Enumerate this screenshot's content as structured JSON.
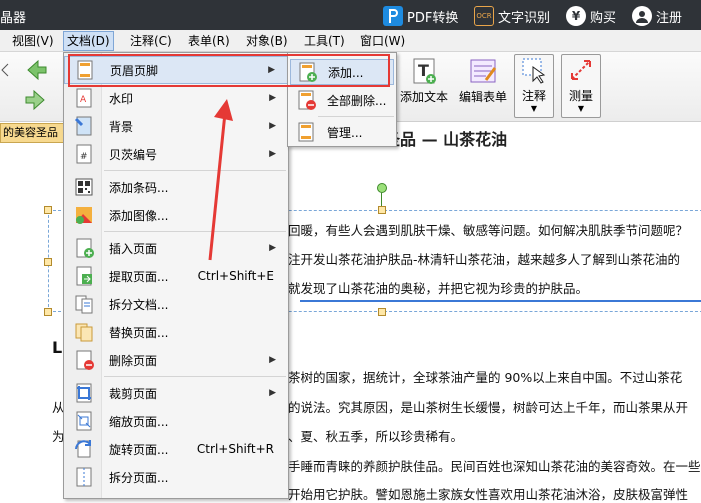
{
  "titlebar": {
    "app_title": "晶器",
    "pdf_convert": "PDF转换",
    "ocr_badge": "OCR",
    "ocr": "文字识别",
    "buy": "购买",
    "register": "注册"
  },
  "menubar": {
    "items": [
      "视图(V)",
      "文档(D)",
      "注释(C)",
      "表单(R)",
      "对象(B)",
      "工具(T)",
      "窗口(W)"
    ]
  },
  "toolbar": {
    "add_text": "添加文本",
    "edit_form": "编辑表单",
    "annotate": "注释",
    "measure": "测量"
  },
  "doc_tab": "的美容圣品",
  "document": {
    "heading": "山茶油的美容圣品  —  山茶花油",
    "lines": [
      "回暖，有些人会遇到肌肤干燥、敏感等问题。如何解决肌肤季节问题呢？",
      "注开发山茶花油护肤品-林清轩山茶花油，越来越多人了解到山茶花油的",
      "就发现了山茶花油的奥秘，并把它视为珍贵的护肤品。",
      "茶树的国家，据统计，全球茶油产量的 90%以上来自中国。不过山茶花",
      "的说法。究其原因，是山茶树生长缓慢，树龄可达上千年，而山茶果从开",
      "、夏、秋五季，所以珍贵稀有。",
      "手睡而青睐的养颜护肤佳品。民间百姓也深知山茶花油的美容奇效。在一些",
      "开始用它护肤。譬如恩施土家族女性喜欢用山茶花油沐浴，皮肤极富弹性"
    ],
    "left_fragments": [
      "L",
      "从",
      "为"
    ]
  },
  "menu": {
    "items": [
      {
        "label": "页眉页脚",
        "shortcut": "",
        "submenu": true
      },
      {
        "label": "水印",
        "shortcut": "",
        "submenu": true
      },
      {
        "label": "背景",
        "shortcut": "",
        "submenu": true
      },
      {
        "label": "贝茨编号",
        "shortcut": "",
        "submenu": true
      },
      {
        "label": "添加条码...",
        "shortcut": "",
        "submenu": false
      },
      {
        "label": "添加图像...",
        "shortcut": "",
        "submenu": false
      },
      {
        "label": "插入页面",
        "shortcut": "",
        "submenu": true
      },
      {
        "label": "提取页面...",
        "shortcut": "Ctrl+Shift+E",
        "submenu": false
      },
      {
        "label": "拆分文档...",
        "shortcut": "",
        "submenu": false
      },
      {
        "label": "替换页面...",
        "shortcut": "",
        "submenu": false
      },
      {
        "label": "删除页面",
        "shortcut": "",
        "submenu": true
      },
      {
        "label": "裁剪页面",
        "shortcut": "",
        "submenu": true
      },
      {
        "label": "缩放页面...",
        "shortcut": "",
        "submenu": false
      },
      {
        "label": "旋转页面...",
        "shortcut": "Ctrl+Shift+R",
        "submenu": false
      },
      {
        "label": "拆分页面...",
        "shortcut": "",
        "submenu": false
      }
    ],
    "arrow": "▶"
  },
  "submenu": {
    "items": [
      "添加...",
      "全部删除...",
      "管理..."
    ]
  },
  "colors": {
    "highlight_box": "#e53935",
    "menu_highlight": "#dce7f5",
    "titlebar_bg": "#2f3338"
  }
}
